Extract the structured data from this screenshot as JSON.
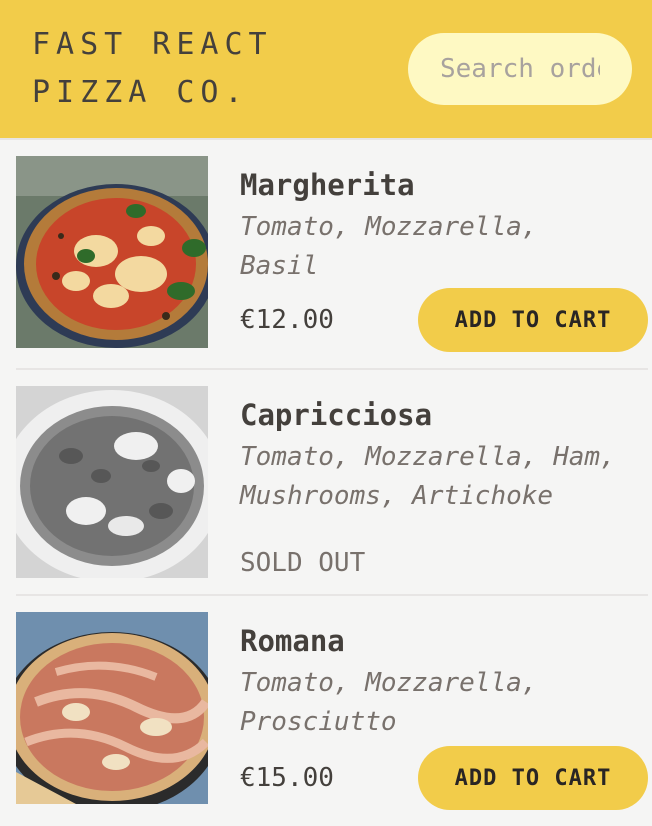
{
  "header": {
    "logo": "FAST REACT PIZZA CO.",
    "search_placeholder": "Search order #"
  },
  "menu": {
    "items": [
      {
        "name": "Margherita",
        "ingredients": "Tomato, Mozzarella,\nBasil",
        "price": "€12.00",
        "action_label": "ADD TO CART",
        "sold_out": false
      },
      {
        "name": "Capricciosa",
        "ingredients": "Tomato, Mozzarella, Ham,\nMushrooms, Artichoke",
        "status_label": "SOLD OUT",
        "sold_out": true
      },
      {
        "name": "Romana",
        "ingredients": "Tomato, Mozzarella,\nProsciutto",
        "price": "€15.00",
        "action_label": "ADD TO CART",
        "sold_out": false
      }
    ]
  },
  "colors": {
    "brand_yellow": "#f2cc4a",
    "search_bg": "#fef9c3",
    "page_bg": "#f5f5f4",
    "text": "#44403c",
    "muted_text": "#78716c"
  }
}
